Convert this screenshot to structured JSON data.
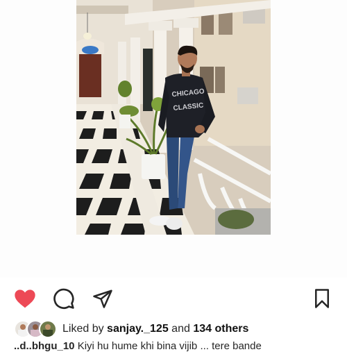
{
  "post": {
    "image_alt": "Man standing in an ornate hallway with checkered floor",
    "liked_by_prefix": "Liked by",
    "liked_by_user": "sanjay._125",
    "liked_by_joiner": "and",
    "liked_by_others": "134 others",
    "caption_user": "..d..bhgu_10",
    "caption_text": "Kiyi hu hume khi bina vijib ... tere bande"
  },
  "icons": {
    "like": "heart-filled-icon",
    "comment": "comment-bubble-icon",
    "share": "paper-plane-icon",
    "save": "bookmark-icon"
  },
  "colors": {
    "like_red": "#ed4956",
    "icon_dark": "#262626",
    "text": "#262626"
  }
}
